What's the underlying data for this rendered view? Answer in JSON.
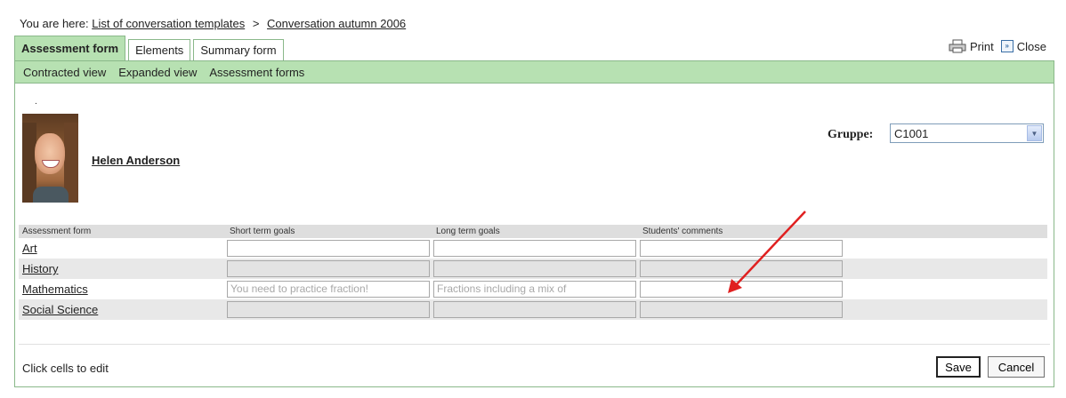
{
  "breadcrumb": {
    "prefix": "You are here:",
    "link1": "List of conversation templates",
    "sep": ">",
    "link2": "Conversation autumn 2006"
  },
  "tabs": [
    "Assessment form",
    "Elements",
    "Summary form"
  ],
  "toplinks": {
    "print": "Print",
    "close": "Close"
  },
  "subnav": [
    "Contracted view",
    "Expanded view",
    "Assessment forms"
  ],
  "student": {
    "dot": ".",
    "name": "Helen Anderson"
  },
  "group": {
    "label": "Gruppe:",
    "value": "C1001"
  },
  "table": {
    "headers": [
      "Assessment form",
      "Short term goals",
      "Long term goals",
      "Students' comments"
    ],
    "rows": [
      {
        "subject": "Art",
        "short": "",
        "long": "",
        "comments": ""
      },
      {
        "subject": "History",
        "short": "",
        "long": "",
        "comments": ""
      },
      {
        "subject": "Mathematics",
        "short": "You need to practice fraction!",
        "long": "Fractions including a mix of",
        "comments": ""
      },
      {
        "subject": "Social Science",
        "short": "",
        "long": "",
        "comments": ""
      }
    ]
  },
  "footer": {
    "hint": "Click cells to edit",
    "save": "Save",
    "cancel": "Cancel"
  },
  "colors": {
    "green_bar": "#b7e1b2",
    "border_green": "#8ab88a",
    "arrow_red": "#e02020"
  }
}
